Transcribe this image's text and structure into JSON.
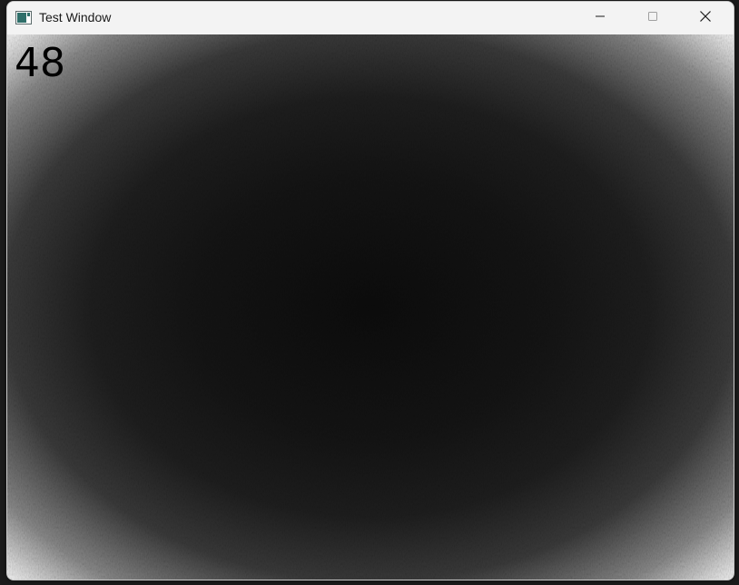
{
  "window": {
    "title": "Test Window",
    "icon": "app-window-icon",
    "controls": {
      "minimize_icon": "minimize-icon",
      "maximize_icon": "maximize-icon",
      "close_icon": "close-icon"
    }
  },
  "canvas": {
    "counter": "48",
    "colors": {
      "center": "#0c0c0c",
      "edge": "#eeeeee"
    }
  }
}
